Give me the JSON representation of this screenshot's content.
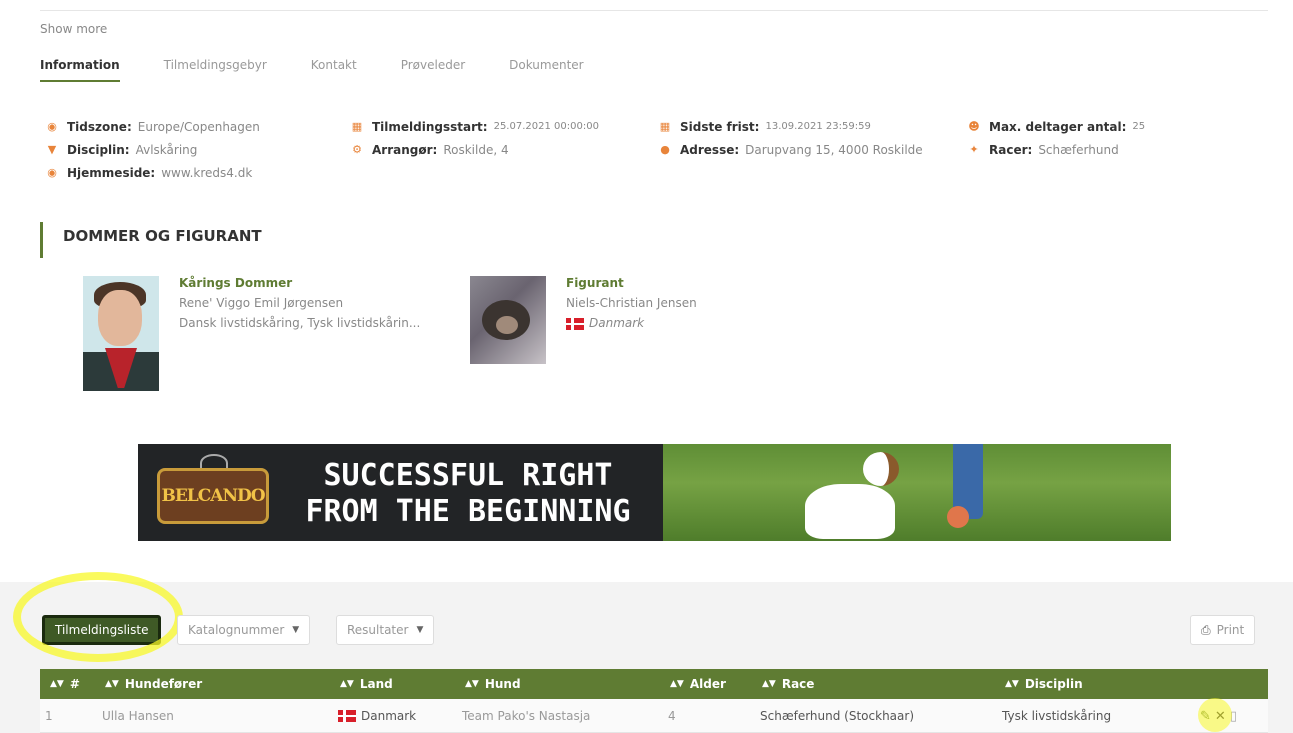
{
  "show_more": "Show more",
  "tabs": [
    {
      "label": "Information",
      "active": true
    },
    {
      "label": "Tilmeldingsgebyr"
    },
    {
      "label": "Kontakt"
    },
    {
      "label": "Prøveleder"
    },
    {
      "label": "Dokumenter"
    }
  ],
  "info": {
    "tidszone": {
      "label": "Tidszone:",
      "value": "Europe/Copenhagen",
      "icon": "globe-icon"
    },
    "disciplin": {
      "label": "Disciplin:",
      "value": "Avlskåring",
      "icon": "trophy-icon"
    },
    "hjemmeside": {
      "label": "Hjemmeside:",
      "value": "www.kreds4.dk",
      "icon": "globe-icon"
    },
    "tilmeldingsstart": {
      "label": "Tilmeldingsstart:",
      "value": "25.07.2021 00:00:00",
      "icon": "calendar-icon"
    },
    "arrangor": {
      "label": "Arrangør:",
      "value": "Roskilde, 4",
      "icon": "gear-icon"
    },
    "sidste_frist": {
      "label": "Sidste frist:",
      "value": "13.09.2021 23:59:59",
      "icon": "calendar-icon"
    },
    "adresse": {
      "label": "Adresse:",
      "value": "Darupvang 15, 4000 Roskilde",
      "icon": "map-marker-icon"
    },
    "max_deltager": {
      "label": "Max. deltager antal:",
      "value": "25",
      "icon": "people-icon"
    },
    "racer": {
      "label": "Racer:",
      "value": "Schæferhund",
      "icon": "paw-icon"
    }
  },
  "section_title": "DOMMER OG FIGURANT",
  "judge": {
    "role": "Kårings Dommer",
    "name": "Rene' Viggo Emil Jørgensen",
    "disciplines": "Dansk livstidskåring, Tysk livstidskårin..."
  },
  "figurant": {
    "role": "Figurant",
    "name": "Niels-Christian Jensen",
    "country": "Danmark"
  },
  "banner": {
    "logo": "BELCANDO",
    "line1": "SUCCESSFUL RIGHT",
    "line2": "FROM THE BEGINNING"
  },
  "toolbar": {
    "tilmeldingsliste": "Tilmeldingsliste",
    "katalognummer": "Katalognummer",
    "resultater": "Resultater",
    "print": "Print"
  },
  "table": {
    "headers": [
      "#",
      "Hundefører",
      "Land",
      "Hund",
      "Alder",
      "Race",
      "Disciplin"
    ],
    "rows": [
      {
        "num": "1",
        "handler": "Ulla Hansen",
        "country": "Danmark",
        "dog": "Team Pako's Nastasja",
        "age": "4",
        "race": "Schæferhund (Stockhaar)",
        "discipline": "Tysk livstidskåring"
      }
    ]
  },
  "colors": {
    "accent": "#5f7c33",
    "icon": "#e8843a",
    "highlight": "#f8f828"
  }
}
